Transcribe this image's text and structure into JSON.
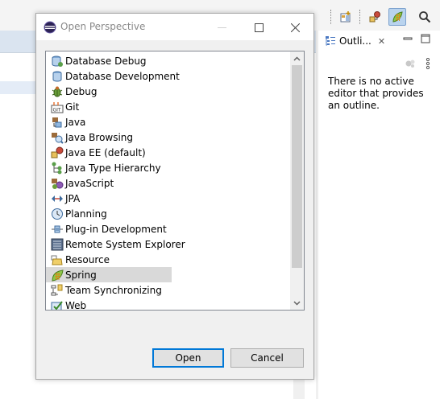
{
  "dialog": {
    "title": "Open Perspective",
    "open_label": "Open",
    "cancel_label": "Cancel"
  },
  "perspectives": [
    {
      "label": "Database Debug",
      "icon": "database-debug-icon"
    },
    {
      "label": "Database Development",
      "icon": "database-development-icon"
    },
    {
      "label": "Debug",
      "icon": "debug-bug-icon"
    },
    {
      "label": "Git",
      "icon": "git-icon"
    },
    {
      "label": "Java",
      "icon": "java-icon"
    },
    {
      "label": "Java Browsing",
      "icon": "java-browsing-icon"
    },
    {
      "label": "Java EE (default)",
      "icon": "java-ee-icon"
    },
    {
      "label": "Java Type Hierarchy",
      "icon": "type-hierarchy-icon"
    },
    {
      "label": "JavaScript",
      "icon": "javascript-icon"
    },
    {
      "label": "JPA",
      "icon": "jpa-icon"
    },
    {
      "label": "Planning",
      "icon": "planning-clock-icon"
    },
    {
      "label": "Plug-in Development",
      "icon": "plugin-icon"
    },
    {
      "label": "Remote System Explorer",
      "icon": "remote-system-icon"
    },
    {
      "label": "Resource",
      "icon": "resource-folder-icon"
    },
    {
      "label": "Spring",
      "icon": "spring-leaf-icon"
    },
    {
      "label": "Team Synchronizing",
      "icon": "team-sync-icon"
    },
    {
      "label": "Web",
      "icon": "web-icon"
    }
  ],
  "selected_index": 14,
  "outline": {
    "tab_label": "Outli...",
    "message": "There is no active editor that provides an outline."
  },
  "colors": {
    "selection": "#d9d9d9",
    "default_button_border": "#0078d7",
    "active_toolbar": "#b9d3ee"
  }
}
